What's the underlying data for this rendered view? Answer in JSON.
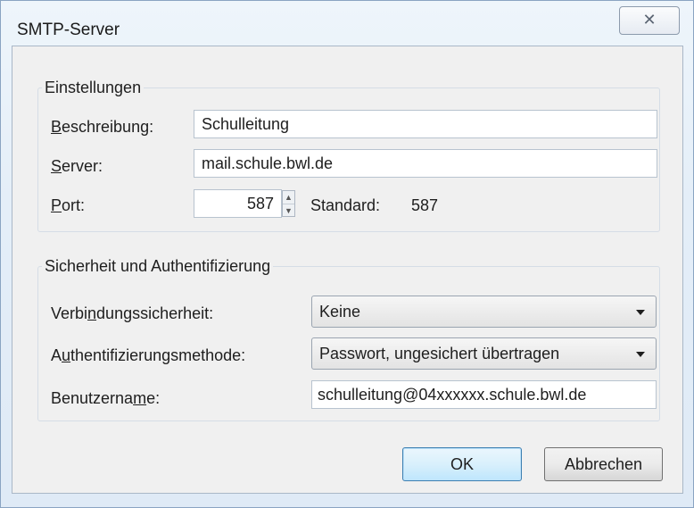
{
  "window": {
    "title": "SMTP-Server",
    "close_glyph": "✕"
  },
  "settings": {
    "legend": "Einstellungen",
    "description": {
      "label_key": "B",
      "label_rest": "eschreibung:",
      "value": "Schulleitung"
    },
    "server": {
      "label_key": "S",
      "label_rest": "erver:",
      "value": "mail.schule.bwl.de"
    },
    "port": {
      "label_key": "P",
      "label_rest": "ort:",
      "value": "587",
      "default_label": "Standard:",
      "default_value": "587"
    }
  },
  "security": {
    "legend": "Sicherheit und Authentifizierung",
    "connection": {
      "label_pre": "Verbi",
      "label_key": "n",
      "label_post": "dungssicherheit:",
      "value": "Keine"
    },
    "auth_method": {
      "label_pre": "A",
      "label_key": "u",
      "label_post": "thentifizierungsmethode:",
      "value": "Passwort, ungesichert übertragen"
    },
    "username": {
      "label_pre": "Benutzerna",
      "label_key": "m",
      "label_post": "e:",
      "value": "schulleitung@04xxxxxx.schule.bwl.de"
    }
  },
  "buttons": {
    "ok": "OK",
    "cancel": "Abbrechen"
  },
  "icons": {
    "close": "close-icon",
    "spin_up": "chevron-up-icon",
    "spin_down": "chevron-down-icon",
    "dropdown": "chevron-down-icon"
  }
}
